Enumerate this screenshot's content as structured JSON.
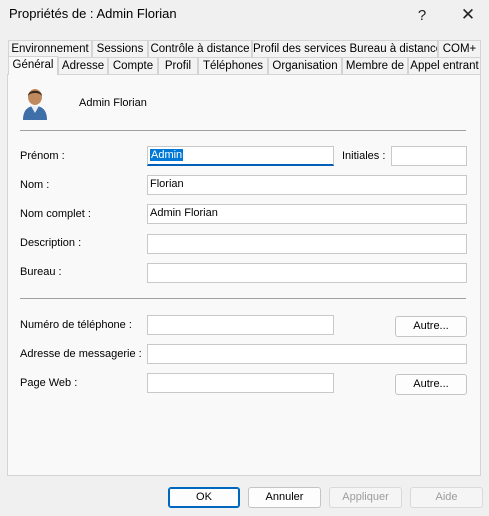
{
  "window": {
    "title": "Propriétés de : Admin Florian",
    "help_glyph": "?",
    "close_glyph": "✕"
  },
  "tabs": {
    "row_back": [
      "Environnement",
      "Sessions",
      "Contrôle à distance",
      "Profil des services Bureau à distance",
      "COM+"
    ],
    "row_front": [
      "Général",
      "Adresse",
      "Compte",
      "Profil",
      "Téléphones",
      "Organisation",
      "Membre de",
      "Appel entrant"
    ],
    "active": "Général"
  },
  "header": {
    "user_icon": "user-icon",
    "display_name": "Admin Florian"
  },
  "form": {
    "prenom": {
      "label": "Prénom :",
      "value": "Admin"
    },
    "initiales": {
      "label": "Initiales :",
      "value": ""
    },
    "nom": {
      "label": "Nom :",
      "value": "Florian"
    },
    "nom_complet": {
      "label": "Nom complet :",
      "value": "Admin Florian"
    },
    "description": {
      "label": "Description :",
      "value": ""
    },
    "bureau": {
      "label": "Bureau :",
      "value": ""
    },
    "telephone": {
      "label": "Numéro de téléphone :",
      "value": "",
      "other_button": "Autre..."
    },
    "messagerie": {
      "label": "Adresse de messagerie :",
      "value": ""
    },
    "page_web": {
      "label": "Page Web :",
      "value": "",
      "other_button": "Autre..."
    }
  },
  "footer": {
    "ok": "OK",
    "cancel": "Annuler",
    "apply": "Appliquer",
    "help": "Aide"
  },
  "colors": {
    "accent": "#0078d7",
    "window_bg": "#f0f0f0",
    "panel_bg": "#f9f9f9"
  }
}
